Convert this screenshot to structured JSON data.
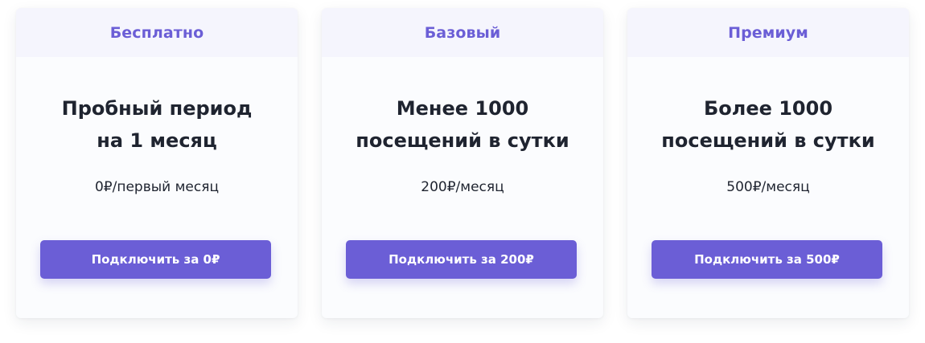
{
  "colors": {
    "accent": "#6b5ed6",
    "header_bg": "#f5f5fd",
    "card_bg": "#fbfcfe",
    "text_dark": "#1f2430"
  },
  "plans": [
    {
      "title": "Бесплатно",
      "heading_line1": "Пробный период",
      "heading_line2": "на 1 месяц",
      "price": "0₽/первый месяц",
      "button_label": "Подключить за 0₽"
    },
    {
      "title": "Базовый",
      "heading_line1": "Менее 1000",
      "heading_line2": "посещений в сутки",
      "price": "200₽/месяц",
      "button_label": "Подключить за 200₽"
    },
    {
      "title": "Премиум",
      "heading_line1": "Более 1000",
      "heading_line2": "посещений в сутки",
      "price": "500₽/месяц",
      "button_label": "Подключить за 500₽"
    }
  ]
}
